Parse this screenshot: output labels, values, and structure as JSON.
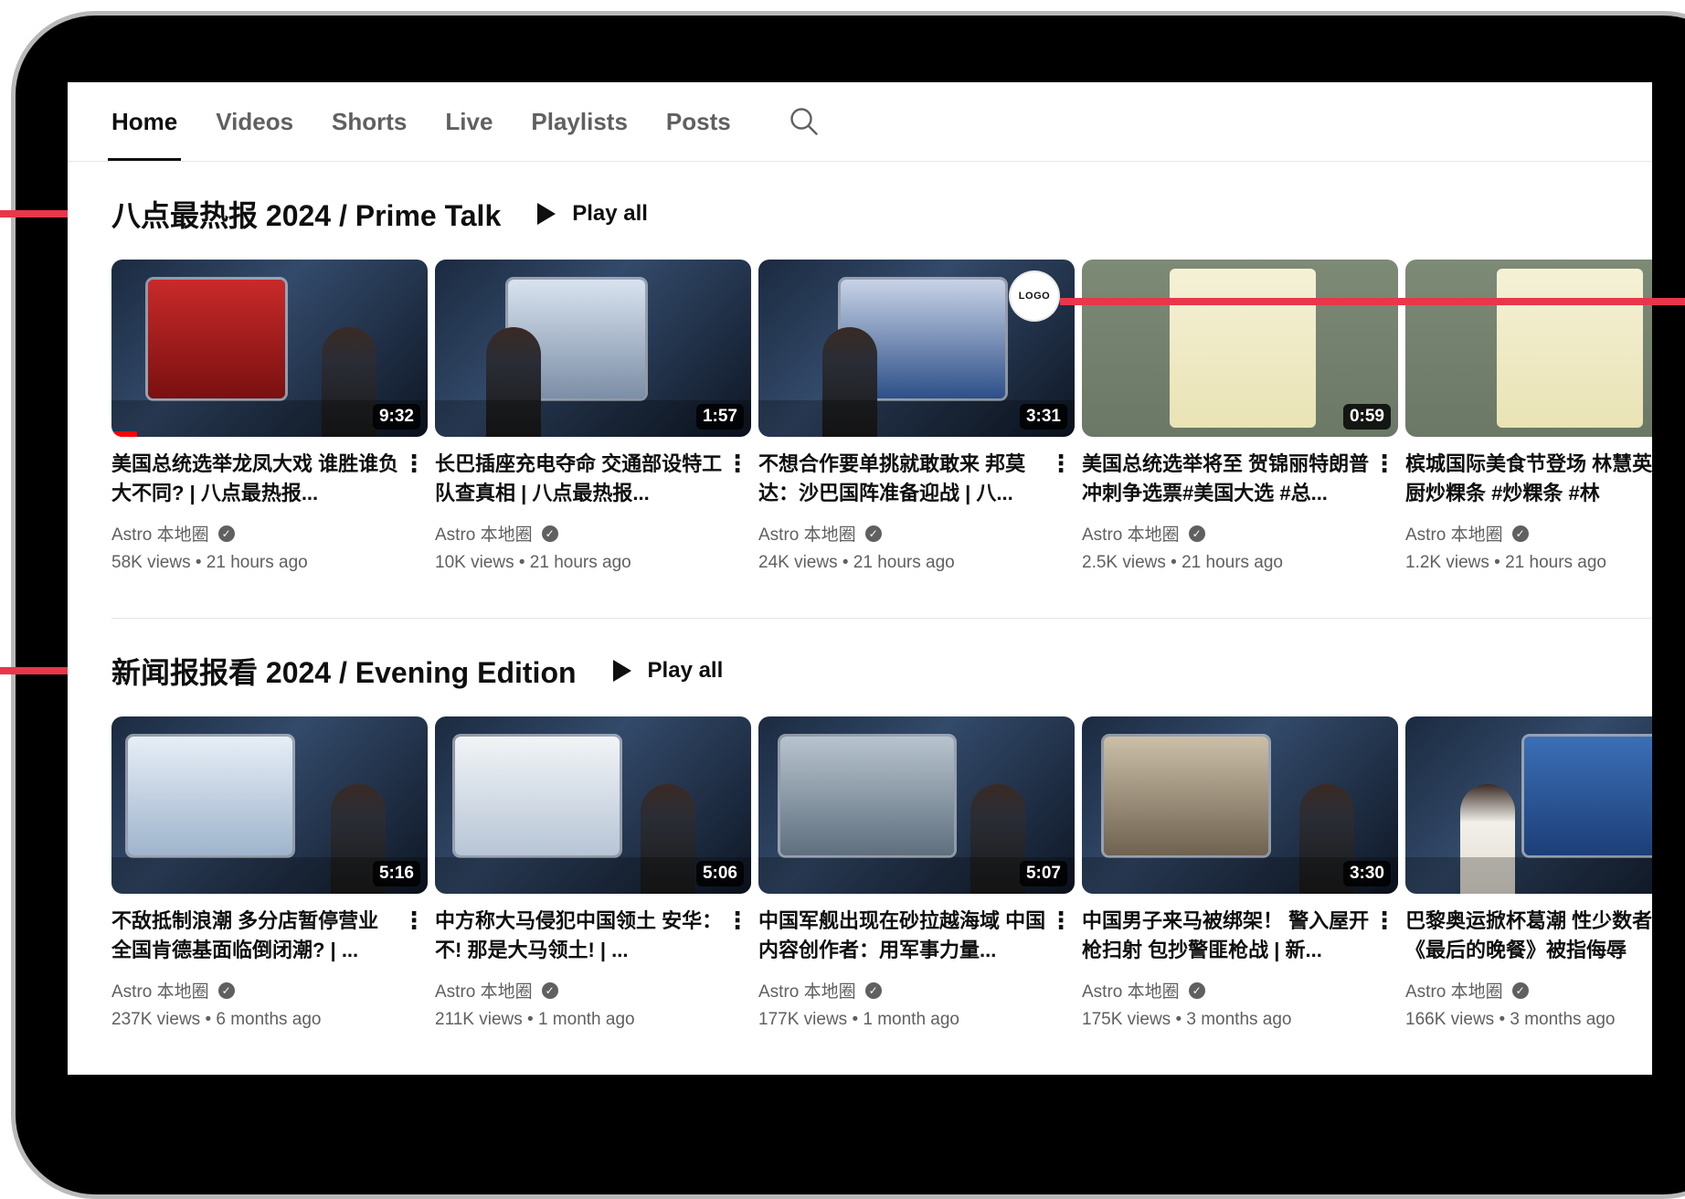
{
  "tabs": [
    {
      "label": "Home",
      "active": true
    },
    {
      "label": "Videos",
      "active": false
    },
    {
      "label": "Shorts",
      "active": false
    },
    {
      "label": "Live",
      "active": false
    },
    {
      "label": "Playlists",
      "active": false
    },
    {
      "label": "Posts",
      "active": false
    }
  ],
  "search_icon": "search-icon",
  "logo_badge": "LOGO",
  "colors": {
    "accent": "#e8374a",
    "progress": "#ff0000",
    "text": "#0f0f0f",
    "muted": "#606060"
  },
  "shelves": [
    {
      "title": "八点最热报 2024 / Prime Talk",
      "play_all": "Play all",
      "videos": [
        {
          "title": "美国总统选举龙凤大戏 谁胜谁负大不同? | 八点最热报...",
          "channel": "Astro 本地圈",
          "stats": "58K views • 21 hours ago",
          "duration": "9:32",
          "watched_fraction": 0.08
        },
        {
          "title": "长巴插座充电夺命 交通部设特工队查真相 | 八点最热报...",
          "channel": "Astro 本地圈",
          "stats": "10K views • 21 hours ago",
          "duration": "1:57"
        },
        {
          "title": "不想合作要单挑就敢敢来 邦莫达：沙巴国阵准备迎战 | 八...",
          "channel": "Astro 本地圈",
          "stats": "24K views • 21 hours ago",
          "duration": "3:31"
        },
        {
          "title": "美国总统选举将至 贺锦丽特朗普冲刺争选票#美国大选 #总...",
          "channel": "Astro 本地圈",
          "stats": "2.5K views • 21 hours ago",
          "duration": "0:59"
        },
        {
          "title": "槟城国际美食节登场 林慧英身大厨炒粿条 #炒粿条 #林",
          "channel": "Astro 本地圈",
          "stats": "1.2K views • 21 hours ago",
          "duration": ""
        }
      ]
    },
    {
      "title": "新闻报报看 2024 / Evening Edition",
      "play_all": "Play all",
      "videos": [
        {
          "title": "不敌抵制浪潮 多分店暂停营业 全国肯德基面临倒闭潮? | ...",
          "channel": "Astro 本地圈",
          "stats": "237K views • 6 months ago",
          "duration": "5:16"
        },
        {
          "title": "中方称大马侵犯中国领土 安华：不! 那是大马领土! | ...",
          "channel": "Astro 本地圈",
          "stats": "211K views • 1 month ago",
          "duration": "5:06"
        },
        {
          "title": "中国军舰出现在砂拉越海域 中国内容创作者：用军事力量...",
          "channel": "Astro 本地圈",
          "stats": "177K views • 1 month ago",
          "duration": "5:07"
        },
        {
          "title": "中国男子来马被绑架！ 警入屋开枪扫射 包抄警匪枪战 | 新...",
          "channel": "Astro 本地圈",
          "stats": "175K views • 3 months ago",
          "duration": "3:30"
        },
        {
          "title": "巴黎奥运掀杯葛潮 性少数者仿《最后的晚餐》被指侮辱",
          "channel": "Astro 本地圈",
          "stats": "166K views • 3 months ago",
          "duration": ""
        }
      ]
    }
  ]
}
